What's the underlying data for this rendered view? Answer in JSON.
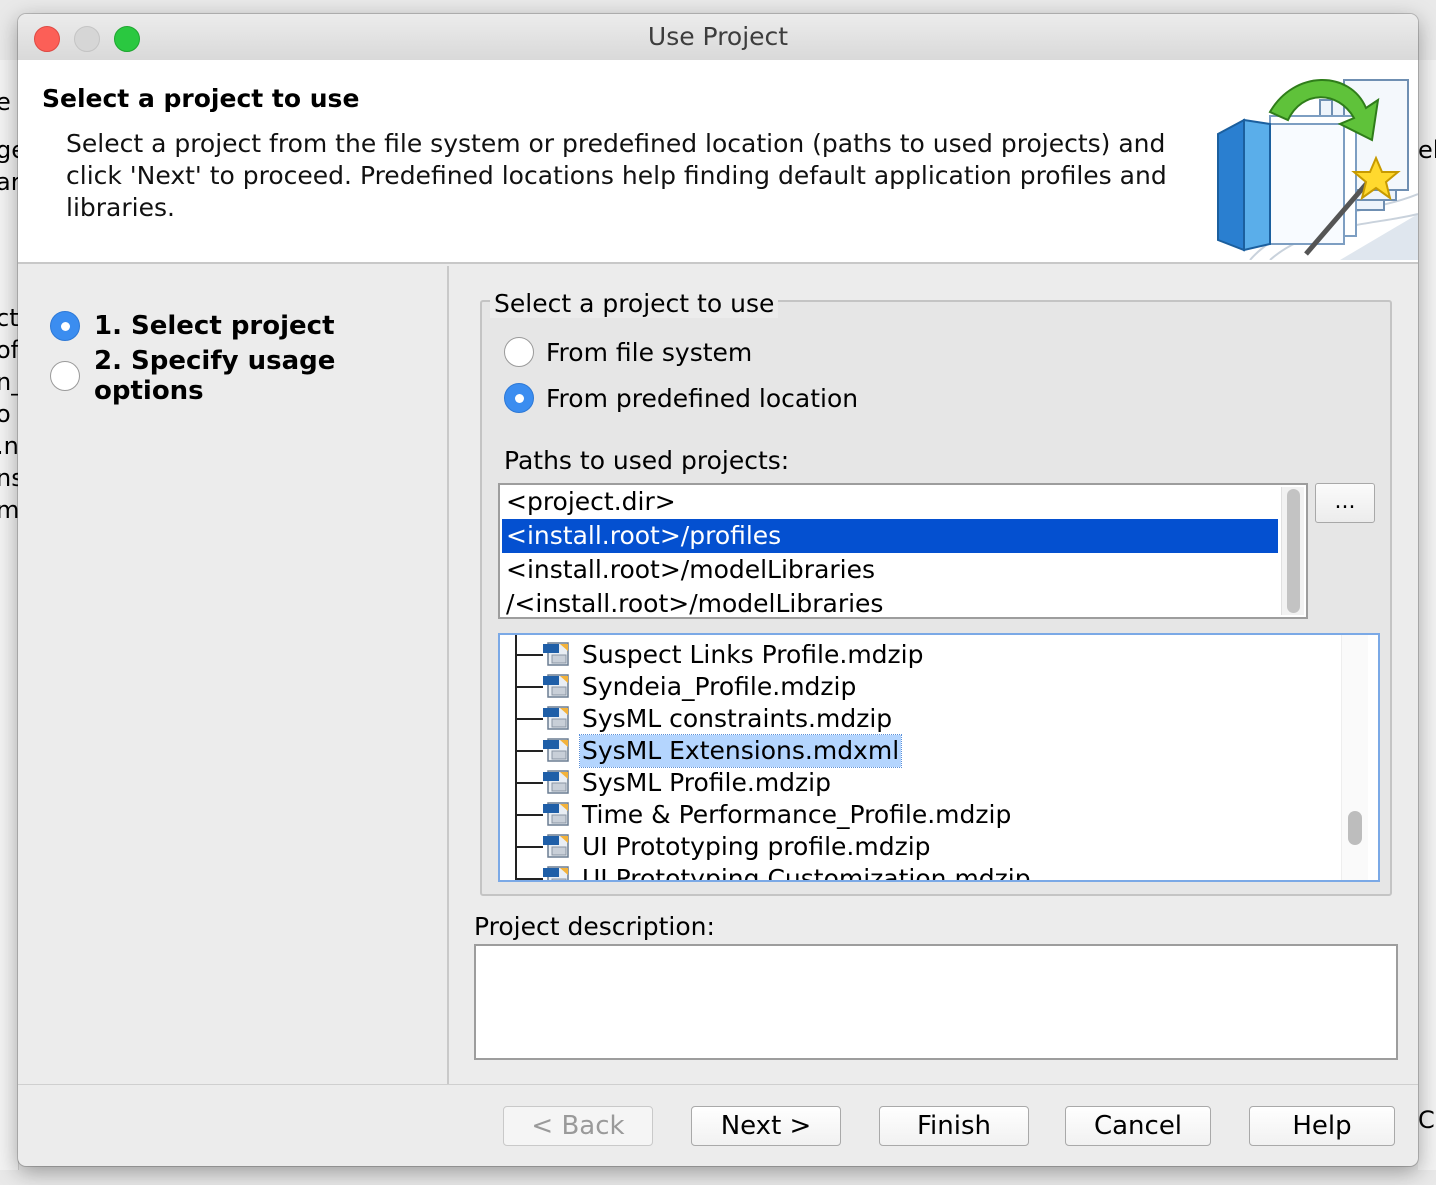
{
  "window": {
    "title": "Use Project"
  },
  "background_fragments": {
    "left": [
      "e",
      "ge",
      "ar",
      "ct",
      "of",
      "n_",
      "o",
      ".n",
      "ns",
      "m"
    ],
    "right": [
      "el",
      "Ca"
    ]
  },
  "header": {
    "title": "Select a project to use",
    "description": "Select a project from the file system or predefined location (paths to used projects) and click 'Next' to proceed. Predefined locations help finding default application profiles and libraries."
  },
  "steps": [
    {
      "label": "1. Select project",
      "active": true
    },
    {
      "label": "2. Specify usage options",
      "active": false
    }
  ],
  "group": {
    "legend": "Select a project to use",
    "options": [
      {
        "label": "From file system",
        "selected": false
      },
      {
        "label": "From predefined location",
        "selected": true
      }
    ],
    "paths_label": "Paths to used projects:",
    "paths": [
      {
        "text": "<project.dir>",
        "selected": false
      },
      {
        "text": "<install.root>/profiles",
        "selected": true
      },
      {
        "text": "<install.root>/modelLibraries",
        "selected": false
      },
      {
        "text": "/<install.root>/modelLibraries",
        "selected": false
      }
    ],
    "browse_label": "...",
    "files": [
      {
        "name": "Suspect Links Profile.mdzip",
        "icon": "md-file-icon",
        "selected": false
      },
      {
        "name": "Syndeia_Profile.mdzip",
        "icon": "md-file-icon",
        "selected": false
      },
      {
        "name": "SysML constraints.mdzip",
        "icon": "md-file-icon",
        "selected": false
      },
      {
        "name": "SysML Extensions.mdxml",
        "icon": "md-file-icon",
        "selected": true
      },
      {
        "name": "SysML Profile.mdzip",
        "icon": "md-file-icon",
        "selected": false
      },
      {
        "name": "Time & Performance_Profile.mdzip",
        "icon": "md-file-icon",
        "selected": false
      },
      {
        "name": "UI Prototyping profile.mdzip",
        "icon": "md-file-icon",
        "selected": false
      },
      {
        "name": "UI Prototyping Customization.mdzip",
        "icon": "md-file-icon",
        "selected": false
      }
    ]
  },
  "description_label": "Project description:",
  "description_value": "",
  "buttons": {
    "back": "< Back",
    "next": "Next >",
    "finish": "Finish",
    "cancel": "Cancel",
    "help": "Help"
  },
  "colors": {
    "selection_blue": "#0450d0",
    "tree_selection": "#b4d5fe",
    "radio_on": "#3b8df0"
  }
}
